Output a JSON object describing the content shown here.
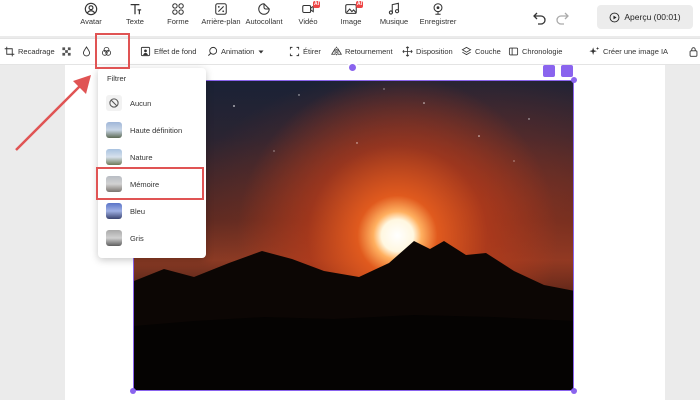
{
  "toolbar": {
    "items": [
      {
        "label": "Avatar",
        "icon": "avatar-icon"
      },
      {
        "label": "Texte",
        "icon": "text-icon"
      },
      {
        "label": "Forme",
        "icon": "shapes-icon"
      },
      {
        "label": "Arrière-plan",
        "icon": "background-icon"
      },
      {
        "label": "Autocollant",
        "icon": "sticker-icon"
      },
      {
        "label": "Vidéo",
        "icon": "video-icon",
        "badge": "AI"
      },
      {
        "label": "Image",
        "icon": "image-icon",
        "badge": "AI"
      },
      {
        "label": "Musique",
        "icon": "music-icon"
      },
      {
        "label": "Enregistrer",
        "icon": "record-icon"
      }
    ],
    "preview_label": "Aperçu (00:01)"
  },
  "edit_toolbar": {
    "crop": "Recadrage",
    "background_effect": "Effet de fond",
    "animation": "Animation",
    "stretch": "Étirer",
    "flip": "Retournement",
    "layout": "Disposition",
    "layer": "Couche",
    "timeline": "Chronologie",
    "ai_image": "Créer une image IA"
  },
  "filter_menu": {
    "title": "Filtrer",
    "items": [
      {
        "label": "Aucun"
      },
      {
        "label": "Haute définition"
      },
      {
        "label": "Nature"
      },
      {
        "label": "Mémoire",
        "highlighted": true
      },
      {
        "label": "Bleu"
      },
      {
        "label": "Gris"
      }
    ]
  },
  "colors": {
    "accent": "#8a64ee",
    "annotation": "#e05454",
    "ai_badge": "#ee4444"
  }
}
